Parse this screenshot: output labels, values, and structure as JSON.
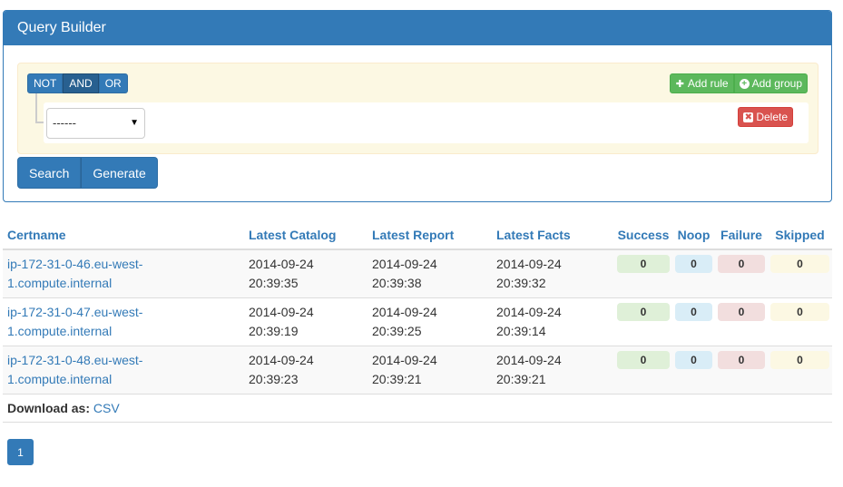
{
  "panel": {
    "title": "Query Builder"
  },
  "query": {
    "conditions": [
      {
        "label": "NOT",
        "active": false
      },
      {
        "label": "AND",
        "active": true
      },
      {
        "label": "OR",
        "active": false
      }
    ],
    "add_rule_label": "Add rule",
    "add_group_label": "Add group",
    "rule_filter_value": "------",
    "delete_label": "Delete"
  },
  "actions": {
    "search_label": "Search",
    "generate_label": "Generate"
  },
  "table": {
    "headers": {
      "certname": "Certname",
      "latest_catalog": "Latest Catalog",
      "latest_report": "Latest Report",
      "latest_facts": "Latest Facts",
      "success": "Success",
      "noop": "Noop",
      "failure": "Failure",
      "skipped": "Skipped"
    },
    "rows": [
      {
        "certname": "ip-172-31-0-46.eu-west-1.compute.internal",
        "catalog_date": "2014-09-24",
        "catalog_time": "20:39:35",
        "report_date": "2014-09-24",
        "report_time": "20:39:38",
        "facts_date": "2014-09-24",
        "facts_time": "20:39:32",
        "success": "0",
        "noop": "0",
        "failure": "0",
        "skipped": "0"
      },
      {
        "certname": "ip-172-31-0-47.eu-west-1.compute.internal",
        "catalog_date": "2014-09-24",
        "catalog_time": "20:39:19",
        "report_date": "2014-09-24",
        "report_time": "20:39:25",
        "facts_date": "2014-09-24",
        "facts_time": "20:39:14",
        "success": "0",
        "noop": "0",
        "failure": "0",
        "skipped": "0"
      },
      {
        "certname": "ip-172-31-0-48.eu-west-1.compute.internal",
        "catalog_date": "2014-09-24",
        "catalog_time": "20:39:23",
        "report_date": "2014-09-24",
        "report_time": "20:39:21",
        "facts_date": "2014-09-24",
        "facts_time": "20:39:21",
        "success": "0",
        "noop": "0",
        "failure": "0",
        "skipped": "0"
      }
    ],
    "download_label": "Download as:",
    "download_link": "CSV"
  },
  "pagination": {
    "current_page": "1"
  },
  "colors": {
    "primary": "#337ab7",
    "success_btn": "#5cb85c",
    "danger_btn": "#d9534f",
    "group_bg": "#fcf8e3",
    "badge_success": "#dff0d8",
    "badge_noop": "#d9edf7",
    "badge_failure": "#f2dede",
    "badge_skipped": "#fcf8e3"
  }
}
